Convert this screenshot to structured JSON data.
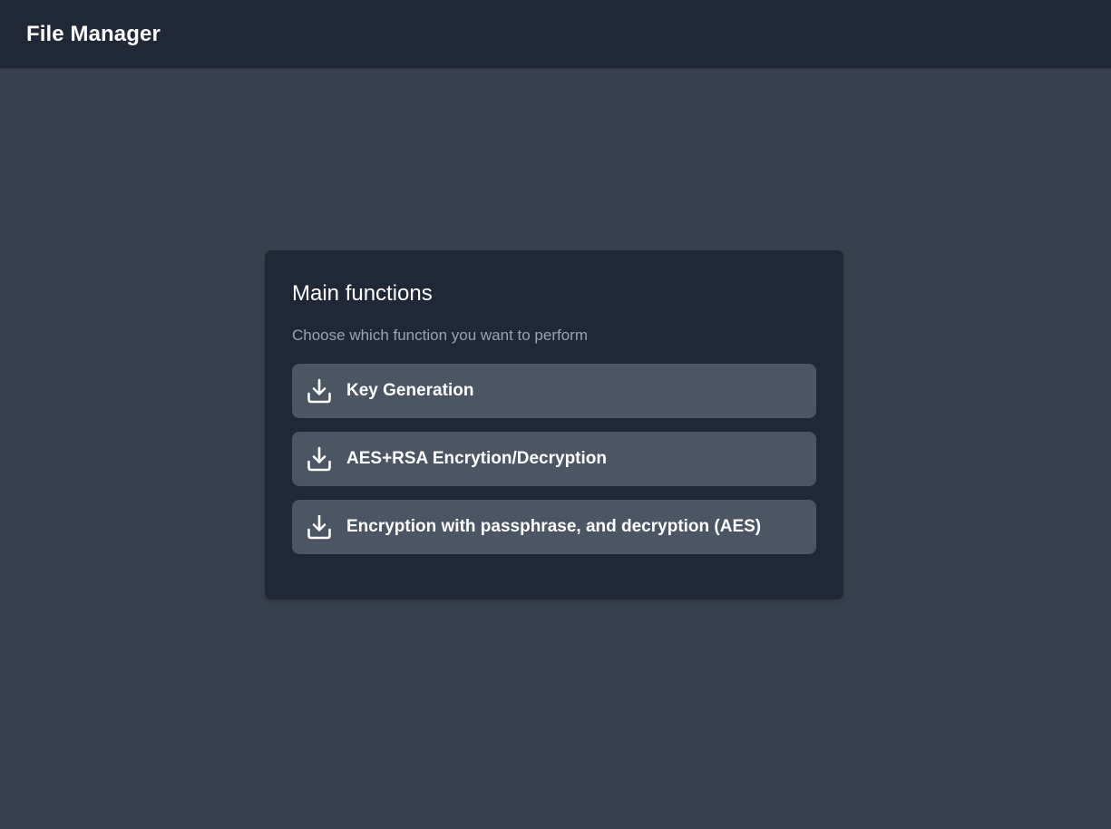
{
  "header": {
    "title": "File Manager"
  },
  "panel": {
    "title": "Main functions",
    "subtitle": "Choose which function you want to perform",
    "buttons": [
      {
        "label": "Key Generation",
        "icon": "download-icon"
      },
      {
        "label": "AES+RSA Encrytion/Decryption",
        "icon": "download-icon"
      },
      {
        "label": "Encryption with passphrase, and decryption (AES)",
        "icon": "download-icon"
      }
    ]
  },
  "colors": {
    "background": "#394150",
    "header_background": "#202837",
    "panel_background": "#202837",
    "button_background": "#4b5563",
    "subtitle_text": "#9aa3b2",
    "text": "#ffffff"
  }
}
